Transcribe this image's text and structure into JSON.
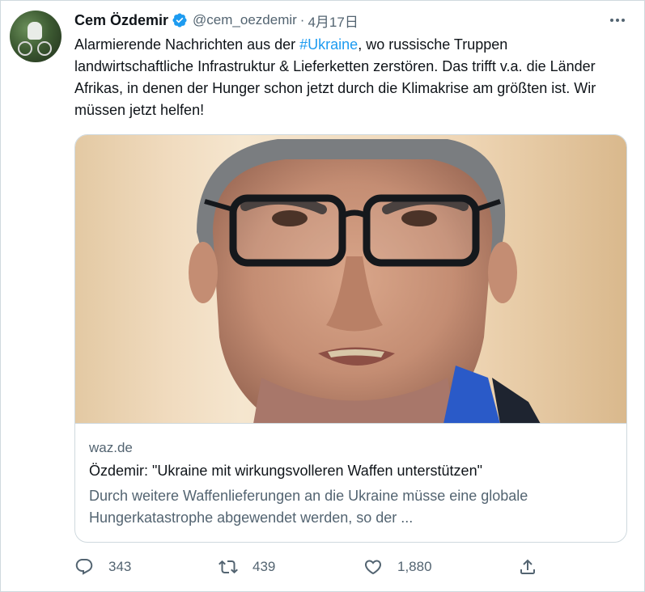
{
  "tweet": {
    "author_name": "Cem Özdemir",
    "handle": "@cem_oezdemir",
    "separator": "·",
    "date": "4月17日",
    "text_before": "Alarmierende Nachrichten aus der ",
    "hashtag": "#Ukraine",
    "text_after": ", wo russische Truppen landwirtschaftliche Infrastruktur & Lieferketten zerstören. Das trifft v.a. die Länder Afrikas, in denen der Hunger schon jetzt durch die Klimakrise am größten ist. Wir müssen jetzt helfen!"
  },
  "card": {
    "domain": "waz.de",
    "title": "Özdemir: \"Ukraine mit wirkungsvolleren Waffen unterstützen\"",
    "description": "Durch weitere Waffenlieferungen an die Ukraine müsse eine globale Hungerkatastrophe abgewendet werden, so der ..."
  },
  "actions": {
    "replies": "343",
    "retweets": "439",
    "likes": "1,880"
  },
  "icons": {
    "verified": "verified-badge-icon",
    "more": "more-options-icon",
    "reply": "reply-icon",
    "retweet": "retweet-icon",
    "like": "heart-icon",
    "share": "share-icon"
  },
  "colors": {
    "link": "#1d9bf0",
    "secondary_text": "#536471",
    "primary_text": "#0f1419",
    "border": "#cfd9de"
  }
}
